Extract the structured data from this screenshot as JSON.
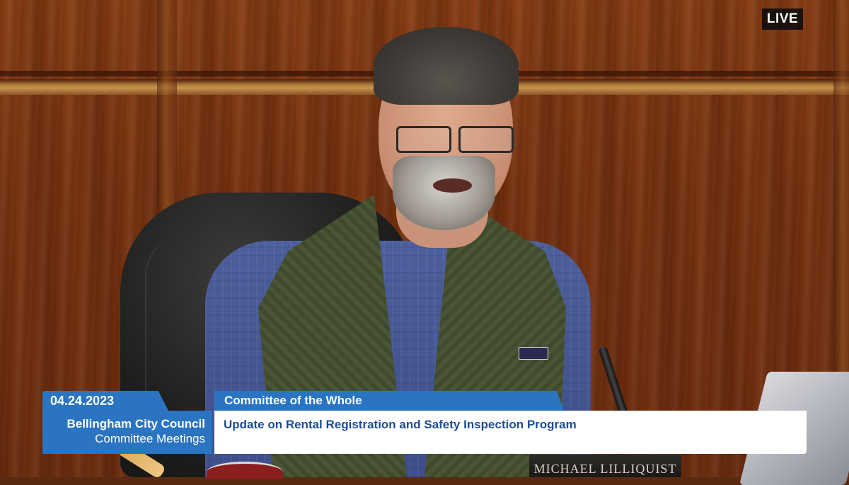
{
  "broadcast": {
    "live_label": "LIVE",
    "date": "04.24.2023",
    "organization": "Bellingham City Council",
    "organization_sub": "Committee Meetings",
    "meeting": "Committee of the Whole",
    "topic": "Update on Rental Registration and Safety Inspection Program"
  },
  "scene": {
    "nameplate": "MICHAEL LILLIQUIST"
  },
  "colors": {
    "accent": "#2a74c2",
    "topic_text": "#1f4e95",
    "wood": "#7a3512"
  }
}
